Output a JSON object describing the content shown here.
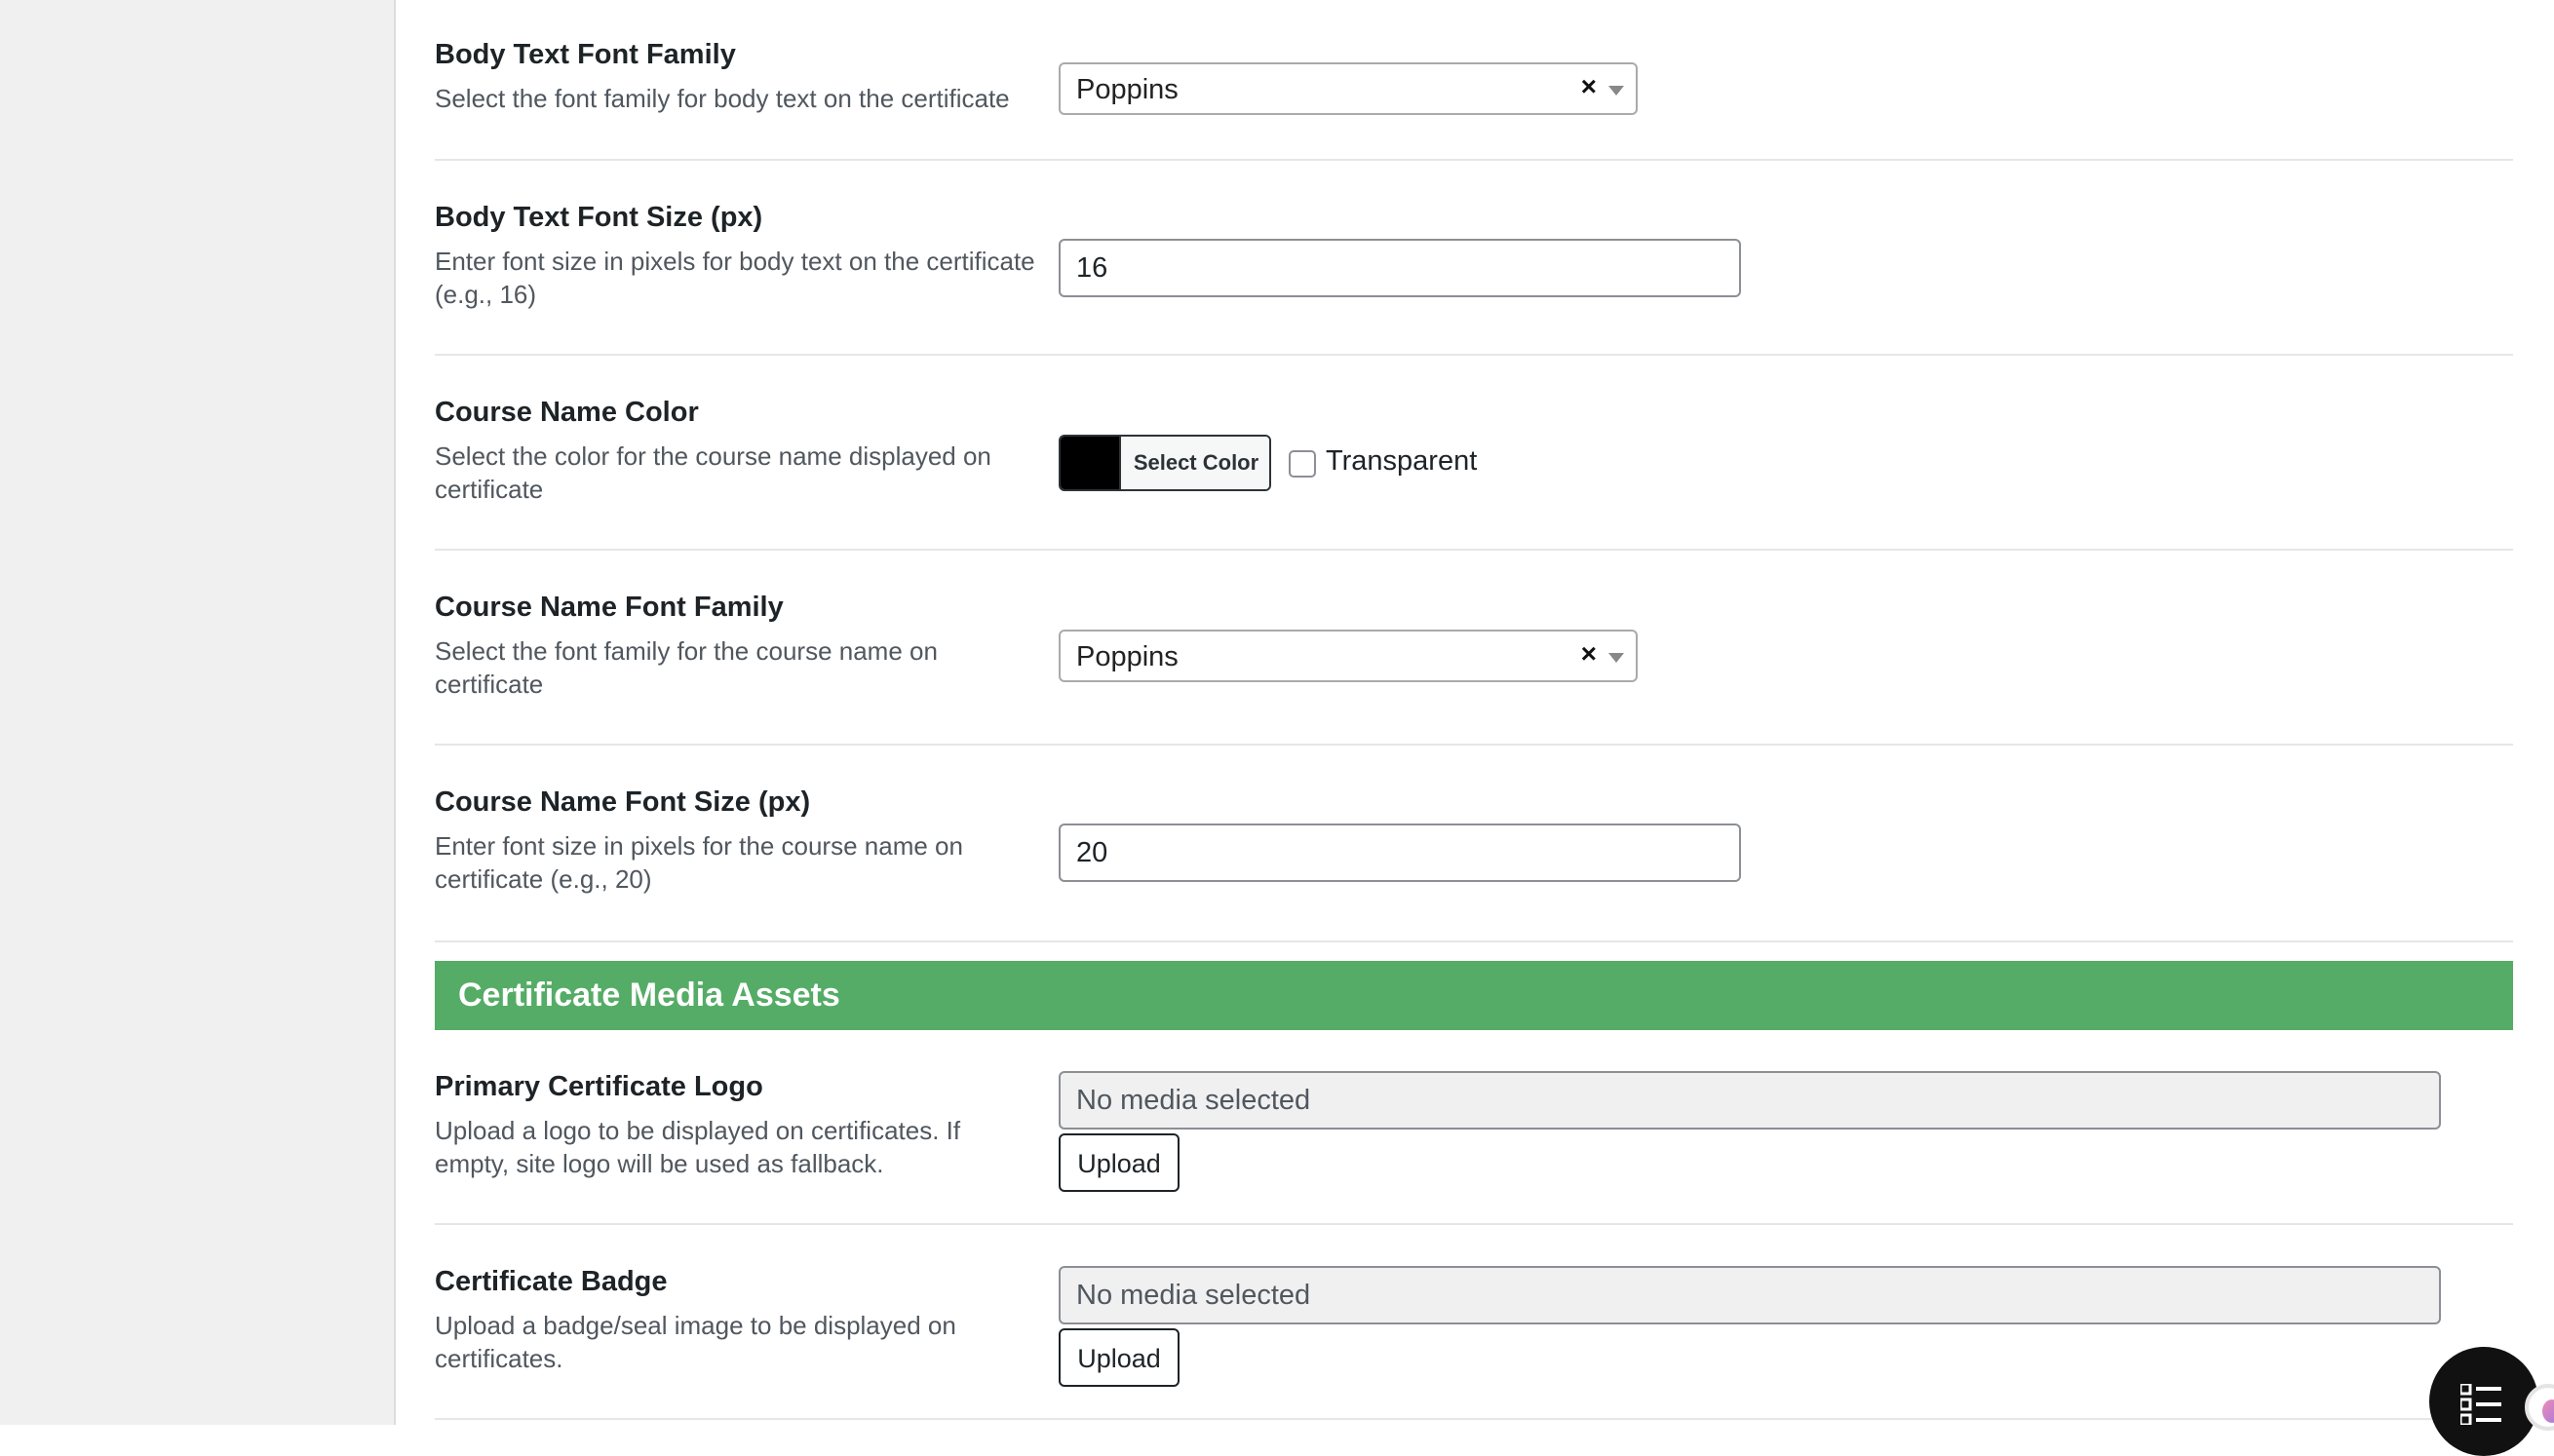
{
  "fields": {
    "body_font_family": {
      "title": "Body Text Font Family",
      "description": "Select the font family for body text on the certificate",
      "value": "Poppins",
      "clear_glyph": "×"
    },
    "body_font_size": {
      "title": "Body Text Font Size (px)",
      "description": "Enter font size in pixels for body text on the certificate (e.g., 16)",
      "value": "16"
    },
    "course_name_color": {
      "title": "Course Name Color",
      "description": "Select the color for the course name displayed on certificate",
      "button_label": "Select Color",
      "swatch_color": "#000000",
      "transparent_label": "Transparent",
      "transparent_checked": false
    },
    "course_name_font_family": {
      "title": "Course Name Font Family",
      "description": "Select the font family for the course name on certificate",
      "value": "Poppins",
      "clear_glyph": "×"
    },
    "course_name_font_size": {
      "title": "Course Name Font Size (px)",
      "description": "Enter font size in pixels for the course name on certificate (e.g., 20)",
      "value": "20"
    }
  },
  "media_section": {
    "title": "Certificate Media Assets",
    "header_color": "#55ac66"
  },
  "media": {
    "primary_logo": {
      "title": "Primary Certificate Logo",
      "description": "Upload a logo to be displayed on certificates. If empty, site logo will be used as fallback.",
      "value": "No media selected",
      "upload_label": "Upload"
    },
    "badge": {
      "title": "Certificate Badge",
      "description": "Upload a badge/seal image to be displayed on certificates.",
      "value": "No media selected",
      "upload_label": "Upload"
    }
  },
  "fab": {
    "icon": "list-icon"
  }
}
